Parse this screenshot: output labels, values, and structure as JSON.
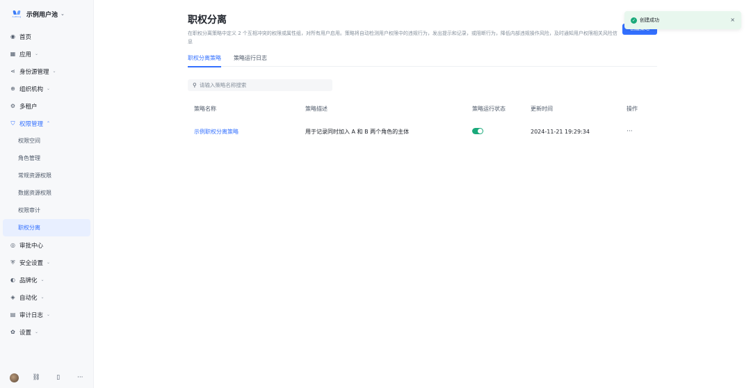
{
  "brand": {
    "name": "示例用户池",
    "logo_text": "Authing"
  },
  "nav": {
    "items": [
      {
        "label": "首页",
        "icon": "globe-icon",
        "chev": ""
      },
      {
        "label": "应用",
        "icon": "grid-icon",
        "chev": "⌄"
      },
      {
        "label": "身份源管理",
        "icon": "share-icon",
        "chev": "⌄"
      },
      {
        "label": "组织机构",
        "icon": "org-icon",
        "chev": "⌄"
      },
      {
        "label": "多租户",
        "icon": "tenant-icon",
        "chev": ""
      },
      {
        "label": "权限管理",
        "icon": "shield-lock-icon",
        "chev": "⌃"
      }
    ],
    "sub_items": [
      "权限空间",
      "角色管理",
      "常规资源权限",
      "数据资源权限",
      "权限审计",
      "职权分离"
    ],
    "items_after": [
      {
        "label": "审批中心",
        "icon": "approval-icon",
        "chev": ""
      },
      {
        "label": "安全设置",
        "icon": "shield-icon",
        "chev": "⌄"
      },
      {
        "label": "品牌化",
        "icon": "brand-icon",
        "chev": "⌄"
      },
      {
        "label": "自动化",
        "icon": "automation-icon",
        "chev": "⌄"
      },
      {
        "label": "审计日志",
        "icon": "log-icon",
        "chev": "⌄"
      },
      {
        "label": "设置",
        "icon": "gear-icon",
        "chev": "⌄"
      }
    ]
  },
  "page": {
    "title": "职权分离",
    "description": "在职权分离策略中定义 2 个互相冲突的权限或属性组，对所有用户启用。策略将自动检测用户权限中的违规行为，发出提示和记录，或阻断行为，降低内部违规操作风险，及时通知用户权限相关风险信息",
    "create_label": "创建策略",
    "tabs": [
      "职权分离策略",
      "策略运行日志"
    ]
  },
  "search": {
    "placeholder": "请输入策略名称搜索"
  },
  "table": {
    "headers": [
      "策略名称",
      "策略描述",
      "策略运行状态",
      "更新时间",
      "操作"
    ],
    "rows": [
      {
        "name": "示例职权分离策略",
        "desc": "用于记录同时加入 A 和 B 两个角色的主体",
        "status": "on",
        "updated": "2024-11-21 19:29:34",
        "action": "···"
      }
    ]
  },
  "toast": {
    "message": "创建成功",
    "close": "×",
    "check": "✓"
  },
  "footer": {
    "link": "⛓",
    "panel": "▯",
    "more": "···"
  },
  "colors": {
    "accent": "#3370ff",
    "success": "#1aa97a",
    "toast_bg": "#e8f7ee"
  }
}
